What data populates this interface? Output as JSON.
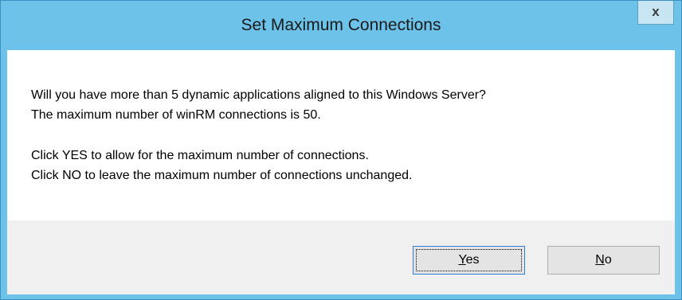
{
  "dialog": {
    "title": "Set Maximum Connections",
    "close_glyph": "x",
    "message_lines": [
      "Will you have more than 5 dynamic applications aligned to this Windows Server?",
      "The maximum number of winRM connections is 50.",
      "Click YES to allow for the maximum number of connections.",
      "Click NO to leave the maximum number of connections unchanged."
    ],
    "buttons": {
      "yes": {
        "mnemonic": "Y",
        "rest": "es"
      },
      "no": {
        "mnemonic": "N",
        "rest": "o"
      }
    }
  },
  "colors": {
    "frame": "#6dc2e9",
    "default_button_border": "#2b7fd6"
  }
}
